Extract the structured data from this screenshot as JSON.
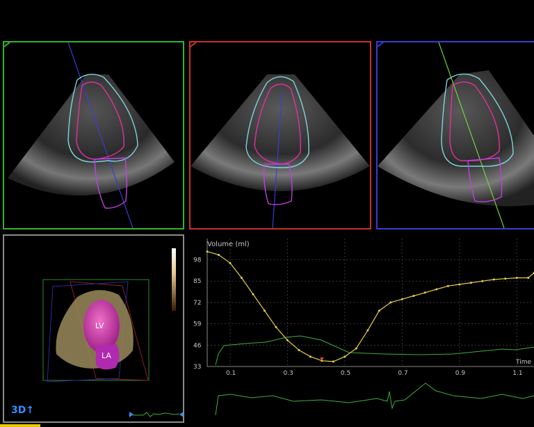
{
  "views": {
    "colors": {
      "a": "#2fb52f",
      "b": "#c9302c",
      "c": "#3b3bd6",
      "d": "#8a8a8a"
    },
    "endocardial_contour_color": "#e0329e",
    "epicardial_contour_color": "#7fd4e0",
    "atrial_contour_color": "#c040e0"
  },
  "view3d": {
    "badge": "3D↑",
    "labels": {
      "lv": "LV",
      "la": "LA"
    }
  },
  "chart_data": {
    "type": "line",
    "ylabel": "Volume (ml)",
    "xlabel": "Time",
    "ylim": [
      33,
      105
    ],
    "xlim": [
      0.02,
      1.16
    ],
    "yticks": [
      "98",
      "85",
      "72",
      "59",
      "46",
      "33"
    ],
    "xticks": [
      "0.1",
      "0.3",
      "0.5",
      "0.7",
      "0.9",
      "1.1"
    ],
    "series": [
      {
        "color": "#e6d04a",
        "x": [
          0.02,
          0.06,
          0.1,
          0.14,
          0.18,
          0.22,
          0.26,
          0.3,
          0.34,
          0.38,
          0.42,
          0.46,
          0.5,
          0.54,
          0.58,
          0.62,
          0.66,
          0.7,
          0.74,
          0.78,
          0.82,
          0.86,
          0.9,
          0.94,
          0.98,
          1.02,
          1.06,
          1.1,
          1.14,
          1.16
        ],
        "y": [
          103,
          101,
          96,
          87,
          77,
          67,
          57,
          49,
          43,
          39,
          36.5,
          36,
          39,
          44,
          55,
          67,
          72,
          74,
          76,
          78,
          80,
          82,
          83,
          84,
          85,
          86,
          86.5,
          87,
          87,
          90
        ]
      }
    ],
    "min_marker": {
      "x": 0.42,
      "y": 36,
      "color": "#e04040"
    },
    "ecg_color": "#3fae3f"
  }
}
